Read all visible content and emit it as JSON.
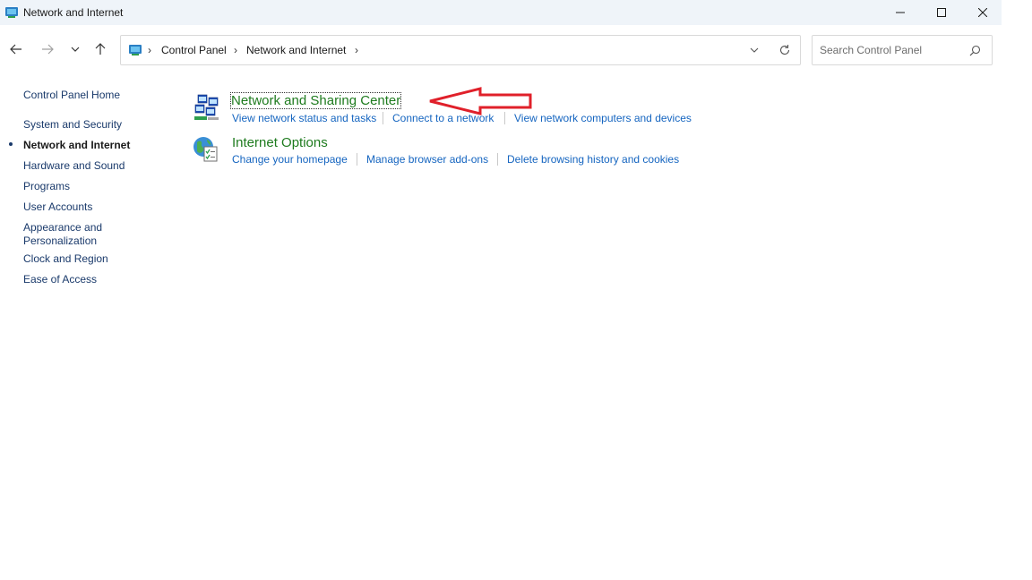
{
  "window": {
    "title": "Network and Internet"
  },
  "addressbar": {
    "crumbs": [
      "Control Panel",
      "Network and Internet"
    ]
  },
  "search": {
    "placeholder": "Search Control Panel"
  },
  "sidebar": {
    "items": [
      {
        "label": "Control Panel Home",
        "active": false
      },
      {
        "label": "System and Security",
        "active": false
      },
      {
        "label": "Network and Internet",
        "active": true
      },
      {
        "label": "Hardware and Sound",
        "active": false
      },
      {
        "label": "Programs",
        "active": false
      },
      {
        "label": "User Accounts",
        "active": false
      },
      {
        "label": "Appearance and Personalization",
        "active": false
      },
      {
        "label": "Clock and Region",
        "active": false
      },
      {
        "label": "Ease of Access",
        "active": false
      }
    ]
  },
  "categories": [
    {
      "title": "Network and Sharing Center",
      "icon": "network-sharing-icon",
      "tasks": [
        "View network status and tasks",
        "Connect to a network",
        "View network computers and devices"
      ]
    },
    {
      "title": "Internet Options",
      "icon": "internet-options-icon",
      "tasks": [
        "Change your homepage",
        "Manage browser add-ons",
        "Delete browsing history and cookies"
      ]
    }
  ],
  "colors": {
    "category_title": "#1e7b1e",
    "task_link": "#1565c0",
    "annotation_arrow": "#e0202a"
  }
}
